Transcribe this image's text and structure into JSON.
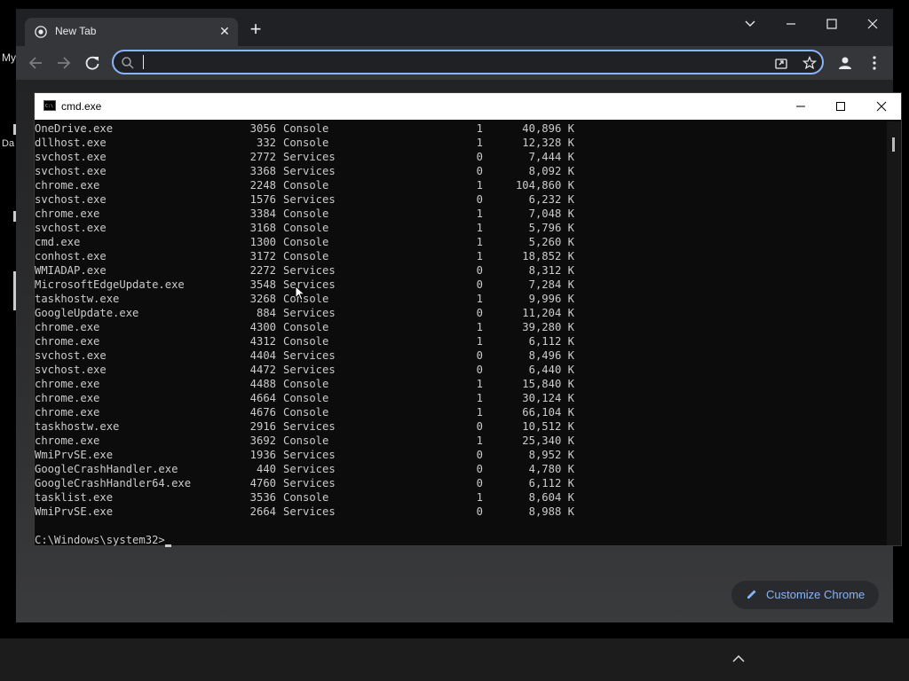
{
  "desktop": {
    "labels": [
      "My",
      "Da"
    ]
  },
  "browser": {
    "tab_title": "New Tab",
    "new_tab_icon": "plus-icon",
    "omnibox_value": "",
    "customize_label": "Customize Chrome"
  },
  "cmd": {
    "title": "cmd.exe",
    "rows": [
      [
        "OneDrive.exe",
        "3056",
        "Console",
        "1",
        "40,896 K"
      ],
      [
        "dllhost.exe",
        "332",
        "Console",
        "1",
        "12,328 K"
      ],
      [
        "svchost.exe",
        "2772",
        "Services",
        "0",
        "7,444 K"
      ],
      [
        "svchost.exe",
        "3368",
        "Services",
        "0",
        "8,092 K"
      ],
      [
        "chrome.exe",
        "2248",
        "Console",
        "1",
        "104,860 K"
      ],
      [
        "svchost.exe",
        "1576",
        "Services",
        "0",
        "6,232 K"
      ],
      [
        "chrome.exe",
        "3384",
        "Console",
        "1",
        "7,048 K"
      ],
      [
        "svchost.exe",
        "3168",
        "Console",
        "1",
        "5,796 K"
      ],
      [
        "cmd.exe",
        "1300",
        "Console",
        "1",
        "5,260 K"
      ],
      [
        "conhost.exe",
        "3172",
        "Console",
        "1",
        "18,852 K"
      ],
      [
        "WMIADAP.exe",
        "2272",
        "Services",
        "0",
        "8,312 K"
      ],
      [
        "MicrosoftEdgeUpdate.exe",
        "3548",
        "Services",
        "0",
        "7,284 K"
      ],
      [
        "taskhostw.exe",
        "3268",
        "Console",
        "1",
        "9,996 K"
      ],
      [
        "GoogleUpdate.exe",
        "884",
        "Services",
        "0",
        "11,204 K"
      ],
      [
        "chrome.exe",
        "4300",
        "Console",
        "1",
        "39,280 K"
      ],
      [
        "chrome.exe",
        "4312",
        "Console",
        "1",
        "6,112 K"
      ],
      [
        "svchost.exe",
        "4404",
        "Services",
        "0",
        "8,496 K"
      ],
      [
        "svchost.exe",
        "4472",
        "Services",
        "0",
        "6,440 K"
      ],
      [
        "chrome.exe",
        "4488",
        "Console",
        "1",
        "15,840 K"
      ],
      [
        "chrome.exe",
        "4664",
        "Console",
        "1",
        "30,124 K"
      ],
      [
        "chrome.exe",
        "4676",
        "Console",
        "1",
        "66,104 K"
      ],
      [
        "taskhostw.exe",
        "2916",
        "Services",
        "0",
        "10,512 K"
      ],
      [
        "chrome.exe",
        "3692",
        "Console",
        "1",
        "25,340 K"
      ],
      [
        "WmiPrvSE.exe",
        "1936",
        "Services",
        "0",
        "8,952 K"
      ],
      [
        "GoogleCrashHandler.exe",
        "440",
        "Services",
        "0",
        "4,780 K"
      ],
      [
        "GoogleCrashHandler64.exe",
        "4760",
        "Services",
        "0",
        "6,112 K"
      ],
      [
        "tasklist.exe",
        "3536",
        "Console",
        "1",
        "8,604 K"
      ],
      [
        "WmiPrvSE.exe",
        "2664",
        "Services",
        "0",
        "8,988 K"
      ]
    ],
    "prompt": "C:\\Windows\\system32>"
  },
  "colors": {
    "accent": "#8ab4f8",
    "console_bg": "#0c0c0c",
    "console_fg": "#cccccc"
  }
}
